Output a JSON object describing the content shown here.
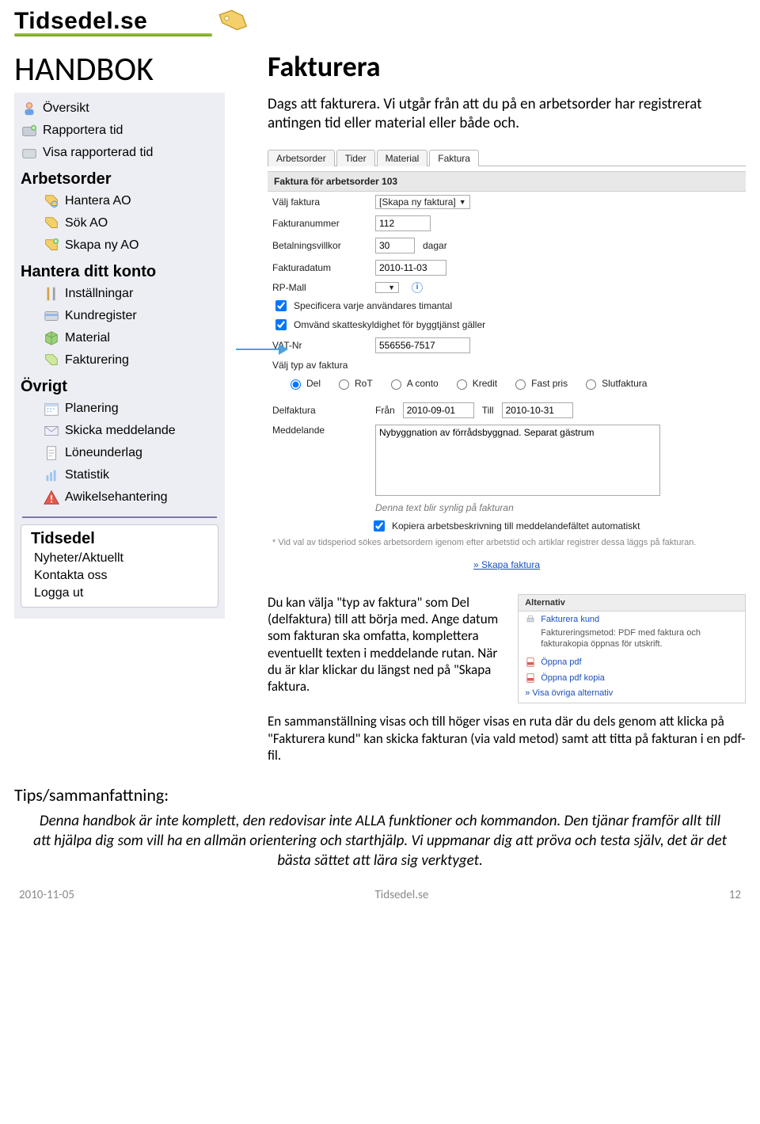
{
  "logo": {
    "text": "Tidsedel.se"
  },
  "handbok": "HANDBOK",
  "sidebar": {
    "overview": "Översikt",
    "report_time": "Rapportera tid",
    "show_reported": "Visa rapporterad tid",
    "arbetsorder_head": "Arbetsorder",
    "hantera_ao": "Hantera AO",
    "sok_ao": "Sök AO",
    "skapa_ny_ao": "Skapa ny AO",
    "konto_head": "Hantera ditt konto",
    "installningar": "Inställningar",
    "kundregister": "Kundregister",
    "material": "Material",
    "fakturering": "Fakturering",
    "ovrigt_head": "Övrigt",
    "planering": "Planering",
    "skicka_meddelande": "Skicka meddelande",
    "loneunderlag": "Löneunderlag",
    "statistik": "Statistik",
    "awikelse": "Awikelsehantering",
    "tidsedel_head": "Tidsedel",
    "nyheter": "Nyheter/Aktuellt",
    "kontakta": "Kontakta oss",
    "logga_ut": "Logga ut"
  },
  "main": {
    "title": "Fakturera",
    "intro": "Dags att fakturera. Vi utgår från att du på en arbetsorder har registrerat antingen tid eller material eller både och.",
    "tabs": [
      "Arbetsorder",
      "Tider",
      "Material",
      "Faktura"
    ],
    "form_title": "Faktura för arbetsorder 103",
    "fields": {
      "valj_faktura_lbl": "Välj faktura",
      "valj_faktura_val": "[Skapa ny faktura]",
      "nummer_lbl": "Fakturanummer",
      "nummer_val": "112",
      "villkor_lbl": "Betalningsvillkor",
      "villkor_val": "30",
      "villkor_unit": "dagar",
      "datum_lbl": "Fakturadatum",
      "datum_val": "2010-11-03",
      "rp_lbl": "RP-Mall",
      "chk1": "Specificera varje användares timantal",
      "chk2": "Omvänd skatteskyldighet för byggtjänst gäller",
      "vat_lbl": "VAT-Nr",
      "vat_val": "556556-7517",
      "typ_lbl": "Välj typ av faktura",
      "radios": [
        "Del",
        "RoT",
        "A conto",
        "Kredit",
        "Fast pris",
        "Slutfaktura"
      ],
      "delfaktura_lbl": "Delfaktura",
      "from_lbl": "Från",
      "from_val": "2010-09-01",
      "till_lbl": "Till",
      "till_val": "2010-10-31",
      "medd_lbl": "Meddelande",
      "medd_val": "Nybyggnation av förrådsbyggnad. Separat gästrum",
      "msg_note": "Denna text blir synlig på fakturan",
      "chk3": "Kopiera arbetsbeskrivning till meddelandefältet automatiskt",
      "help_note": "* Vid val av tidsperiod sökes arbetsordern igenom efter arbetstid och artiklar registrer dessa läggs på fakturan.",
      "skapa_link": "» Skapa faktura"
    },
    "para1": "Du kan välja \"typ av faktura\" som Del (delfaktura) till att börja med. Ange datum som fakturan ska omfatta, komplettera eventuellt texten i meddelande rutan. När du är klar klickar du längst ned på \"Skapa faktura.",
    "alt": {
      "head": "Alternativ",
      "fakturera": "Fakturera kund",
      "metod": "Faktureringsmetod: PDF med faktura och fakturakopia öppnas för utskrift.",
      "oppna_pdf": "Öppna pdf",
      "oppna_pdf_kopia": "Öppna pdf kopia",
      "visa_ovriga": "» Visa övriga alternativ"
    },
    "para2": "En sammanställning visas och till höger visas en ruta där du dels genom att klicka på \"Fakturera kund\" kan skicka fakturan (via vald metod) samt att titta på fakturan i en pdf-fil."
  },
  "tips": {
    "title": "Tips/sammanfattning:",
    "body": "Denna handbok är inte komplett, den redovisar inte ALLA funktioner och kommandon. Den tjänar framför allt till att hjälpa dig som vill ha en allmän orientering och starthjälp. Vi uppmanar dig att pröva och testa själv, det är det bästa sättet att lära sig verktyget."
  },
  "footer": {
    "date": "2010-11-05",
    "site": "Tidsedel.se",
    "page": "12"
  }
}
